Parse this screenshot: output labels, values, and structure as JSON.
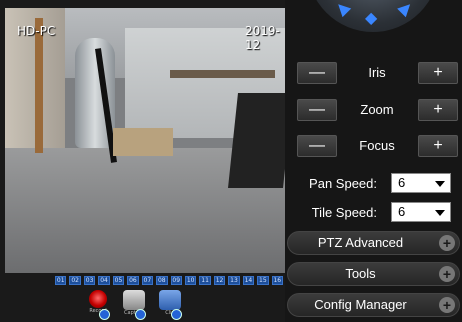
{
  "video": {
    "osd_left": "HD-PC",
    "osd_right": "2019-12"
  },
  "channels": [
    "01",
    "02",
    "03",
    "04",
    "05",
    "06",
    "07",
    "08",
    "09",
    "10",
    "11",
    "12",
    "13",
    "14",
    "15",
    "16"
  ],
  "toolbar": {
    "record_label": "Record",
    "capture_label": "Capture",
    "clip_label": "Clip"
  },
  "ptz": {
    "iris_label": "Iris",
    "zoom_label": "Zoom",
    "focus_label": "Focus",
    "minus_symbol": "—",
    "plus_symbol": "+",
    "pan_speed_label": "Pan Speed:",
    "pan_speed_value": "6",
    "tile_speed_label": "Tile Speed:",
    "tile_speed_value": "6"
  },
  "sections": {
    "ptz_advanced": "PTZ Advanced",
    "tools": "Tools",
    "config_manager": "Config Manager",
    "expand_symbol": "+"
  },
  "colors": {
    "accent": "#3a86ff",
    "panel_bg": "#161616",
    "channel_blue": "#1d4f9c"
  }
}
